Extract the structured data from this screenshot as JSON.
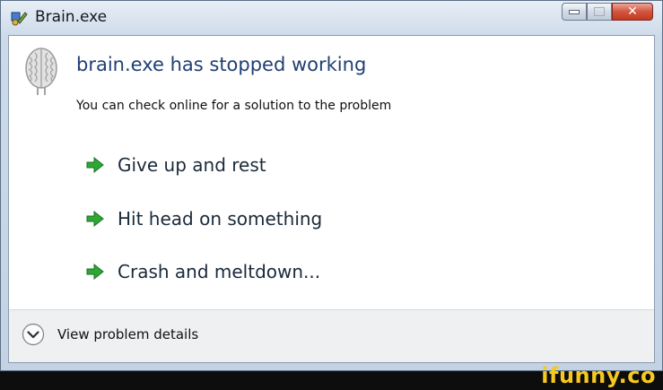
{
  "window": {
    "title": "Brain.exe",
    "caption_buttons": [
      "minimize",
      "maximize",
      "close"
    ]
  },
  "dialog": {
    "headline": "brain.exe has stopped working",
    "subtext": "You can check online for a solution to the problem",
    "options": [
      {
        "label": "Give up and rest",
        "icon": "green-arrow-icon"
      },
      {
        "label": "Hit head on something",
        "icon": "green-arrow-icon"
      },
      {
        "label": "Crash and meltdown...",
        "icon": "green-arrow-icon"
      }
    ],
    "details_label": "View problem details"
  },
  "colors": {
    "headline": "#1f3f73",
    "arrow": "#2da835",
    "close_button": "#c9432c",
    "watermark": "#f7c81e"
  },
  "watermark": "ifunny.co"
}
